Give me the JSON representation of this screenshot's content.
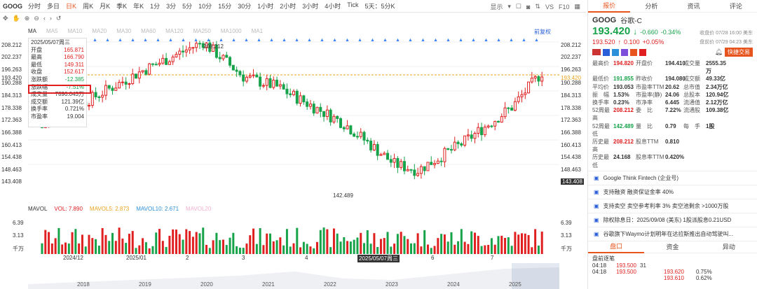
{
  "topbar": {
    "symbol": "GOOG",
    "periods": [
      "分时",
      "多日",
      "日K",
      "周K",
      "月K",
      "季K",
      "年K",
      "1分",
      "3分",
      "5分",
      "10分",
      "15分",
      "30分",
      "1小时",
      "2小时",
      "3小时",
      "4小时",
      "Tick",
      "5天：5分K"
    ],
    "active_period": "日K",
    "display": "显示",
    "vs": "VS",
    "f10": "F10"
  },
  "legend": {
    "ma": "MA",
    "items": [
      "MA5",
      "MA10",
      "MA20",
      "MA30",
      "MA60",
      "MA120",
      "MA250",
      "MA1000",
      "MA1"
    ],
    "fq": "前复权"
  },
  "yaxis": [
    "208.212",
    "202.237",
    "196.263",
    "193.420",
    "190.288",
    "184.313",
    "178.338",
    "172.363",
    "166.388",
    "160.413",
    "154.438",
    "148.463",
    "143.408"
  ],
  "yaxis_r": [
    "208.212",
    "202.237",
    "196.263",
    "193.420",
    "190.288",
    "184.313",
    "178.338",
    "172.363",
    "166.388",
    "160.413",
    "154.438",
    "148.463",
    "143.408"
  ],
  "annot": {
    "high": "208.212",
    "low": "142.489"
  },
  "tooltip": {
    "date": "2025/05/07周三",
    "rows": [
      [
        "开盘",
        "165.871"
      ],
      [
        "最高",
        "166.790"
      ],
      [
        "最低",
        "149.311"
      ],
      [
        "收盘",
        "152.617"
      ],
      [
        "涨跌额",
        "-12.385"
      ],
      [
        "涨跌幅",
        "-7.51%"
      ],
      [
        "成交量",
        "7890.043万"
      ],
      [
        "成交额",
        "121.39亿"
      ],
      [
        "换手率",
        "0.721%"
      ],
      [
        "市盈率",
        "19.004"
      ]
    ]
  },
  "vol": {
    "label": "MAVOL",
    "vol": "VOL: 7.890",
    "mavol5": "MAVOL5: 2.873",
    "mavol10": "MAVOL10: 2.671",
    "mavol20": "MAVOL20",
    "ticks": [
      "6.39",
      "3.13",
      "千万"
    ]
  },
  "xaxis": [
    "2024/12",
    "2025/01",
    "2",
    "3",
    "4",
    "2025/05/07周三",
    "6",
    "7"
  ],
  "mini_years": [
    "2018",
    "2019",
    "2020",
    "2021",
    "2022",
    "2023",
    "2024",
    "2025"
  ],
  "panel": {
    "tabs": [
      "报价",
      "分析",
      "资讯",
      "评论"
    ],
    "symbol": "GOOG",
    "name": "谷歌-C",
    "price": "193.420",
    "arrow": "↓",
    "chg": "-0.660",
    "pct": "-0.34%",
    "close_note": "收盘价 07/28 16:00 美东",
    "pre_price": "193.520",
    "pre_arrow": "↑",
    "pre_chg": "0.100",
    "pre_pct": "+0.05%",
    "pre_note": "盘前价 07/29 04:23 美东",
    "quick": "快捷交易",
    "stats": [
      [
        "最高价",
        "194.820",
        "开盘价",
        "194.410",
        "成交量",
        "2555.35万"
      ],
      [
        "最低价",
        "191.855",
        "昨收价",
        "194.080",
        "成交额",
        "49.33亿"
      ],
      [
        "平均价",
        "193.053",
        "市盈率TTM",
        "20.62",
        "总市值",
        "2.34万亿"
      ],
      [
        "振　幅",
        "1.53%",
        "市盈率(静)",
        "24.06",
        "总股本",
        "120.94亿"
      ],
      [
        "换手率",
        "0.23%",
        "市净率",
        "6.445",
        "流通值",
        "2.12万亿"
      ],
      [
        "52周最高",
        "208.212",
        "委　比",
        "7.22%",
        "流通股",
        "109.38亿"
      ],
      [
        "52周最低",
        "142.489",
        "量　比",
        "0.79",
        "每　手",
        "1股"
      ],
      [
        "历史最高",
        "208.212",
        "股息TTM",
        "0.810",
        "",
        ""
      ],
      [
        "历史最低",
        "24.168",
        "股息率TTM",
        "0.420%",
        "",
        ""
      ]
    ],
    "infos": [
      "Google Think Fintech (企业号)",
      "支持融资 融资保证金率 40%",
      "支持卖空 卖空参考利率 3% 卖空池剩余 >1000万股",
      "除权除息日：2025/09/08 (美东) 1股派股息0.21USD",
      "谷歌旗下Waymo计划明年在达拉斯推出自动驾驶叫..."
    ],
    "btabs": [
      "盘口",
      "资金",
      "异动"
    ],
    "pre_label": "盘前逐笔",
    "ticks": [
      [
        "04:18",
        "193.500",
        "31"
      ],
      [
        "04:18",
        "193.500",
        "",
        "193.620",
        "0.75%"
      ],
      [
        "",
        "",
        "",
        "193.610",
        "0.62%"
      ]
    ]
  }
}
